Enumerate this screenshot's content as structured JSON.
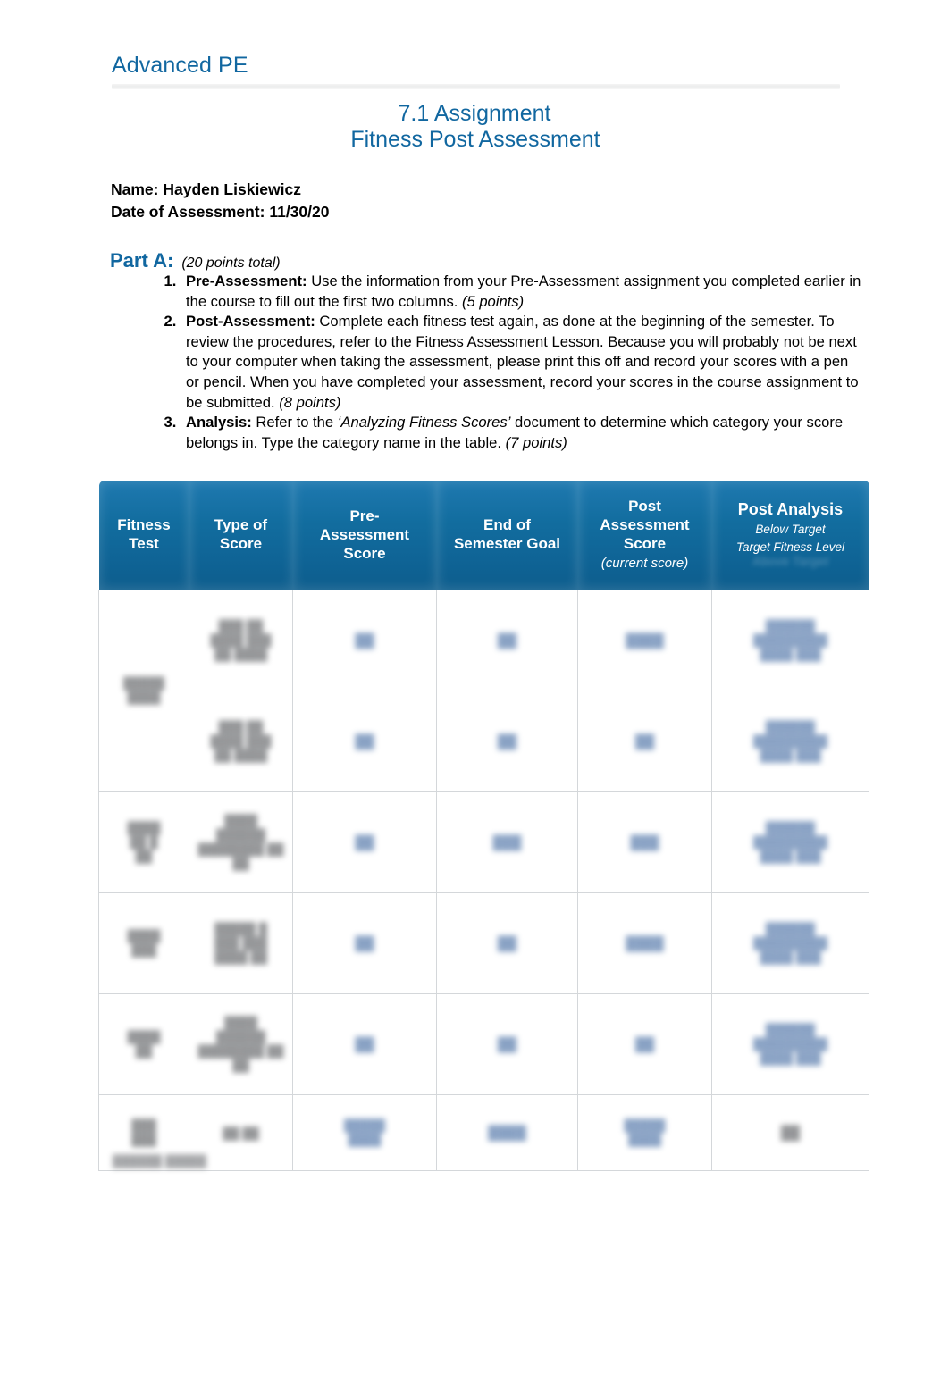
{
  "document": {
    "running_header": "Advanced PE",
    "title_line_1": "7.1 Assignment",
    "title_line_2": "Fitness Post Assessment",
    "name_line": "Name: Hayden Liskiewicz",
    "date_line": "Date of Assessment: 11/30/20"
  },
  "part_a": {
    "label": "Part A:",
    "points": "(20 points total)",
    "items": [
      {
        "bold_lead": "Pre-Assessment:",
        "body": " Use the information from your Pre-Assessment assignment you completed earlier in the course to fill out the first two columns. ",
        "points": "(5 points)"
      },
      {
        "bold_lead": "Post-Assessment:",
        "body": " Complete each fitness test again, as done at the beginning of the semester.  To review the procedures, refer to the Fitness Assessment Lesson.  Because you will probably not be next to your computer when taking the assessment, please print this off and record your scores with a pen or pencil.  When you have completed your assessment, record your scores in the course assignment to be submitted. ",
        "points": "(8 points)"
      },
      {
        "bold_lead": "Analysis:",
        "body_pre": " Refer to the ",
        "quote": "‘Analyzing Fitness Scores’",
        "body_post": " document to determine which category your score belongs in.  Type the category name in the table. ",
        "points": "(7 points)"
      }
    ]
  },
  "table": {
    "headers": {
      "fitness_test": "Fitness\nTest",
      "type_of_score": "Type of\nScore",
      "pre_assessment_score": "Pre-\nAssessment\nScore",
      "end_of_semester_goal": "End of\nSemester Goal",
      "post_assessment_score": "Post\nAssessment\nScore",
      "post_assessment_note": "(current score)",
      "post_analysis_title": "Post Analysis",
      "post_analysis_sub_1": "Below Target",
      "post_analysis_sub_2": "Target Fitness Level",
      "post_analysis_sub_3": "Above Target"
    },
    "header_labels_flat": [
      "Fitness Test",
      "Type of Score",
      "Pre-Assessment Score",
      "End of Semester Goal",
      "Post Assessment Score (current score)",
      "Post Analysis"
    ],
    "rows": [
      {
        "fitness_test": "█████\n████",
        "fitness_test_rowspan": 2,
        "type_of_score": "███ ██\n████ ███\n██ ████",
        "pre_assessment_score": "██",
        "end_of_semester_goal": "██",
        "post_assessment_score": "████",
        "post_analysis": "██████\n█████████\n████ ███"
      },
      {
        "type_of_score": "███ ██\n████ ███\n██ ████",
        "pre_assessment_score": "██",
        "end_of_semester_goal": "██",
        "post_assessment_score": "██",
        "post_analysis": "██████\n█████████\n████ ███"
      },
      {
        "fitness_test": "████\n██ █\n██",
        "type_of_score": "████\n██████\n████████ ██\n██",
        "pre_assessment_score": "██",
        "end_of_semester_goal": "███",
        "post_assessment_score": "███",
        "post_analysis": "██████\n█████████\n████ ███"
      },
      {
        "fitness_test": "████\n███",
        "type_of_score": "█████ █\n███ ███\n████ ██",
        "pre_assessment_score": "██",
        "end_of_semester_goal": "██",
        "post_assessment_score": "████",
        "post_analysis": "██████\n█████████\n████ ███"
      },
      {
        "fitness_test": "████\n██",
        "type_of_score": "████\n██████\n████████ ██\n██",
        "pre_assessment_score": "██",
        "end_of_semester_goal": "██",
        "post_assessment_score": "██",
        "post_analysis": "██████\n█████████\n████ ███"
      },
      {
        "fitness_test": "███\n███",
        "type_of_score": "██ ██",
        "pre_assessment_score": "█████\n████",
        "end_of_semester_goal": "████",
        "post_assessment_score": "█████\n████",
        "post_analysis": "██"
      }
    ]
  },
  "footer": {
    "text": "██████ █████"
  },
  "colors": {
    "brand_blue": "#1167a0",
    "table_header_blue": "#126d9f",
    "table_border": "#d4d7da",
    "body_text": "#000000"
  }
}
